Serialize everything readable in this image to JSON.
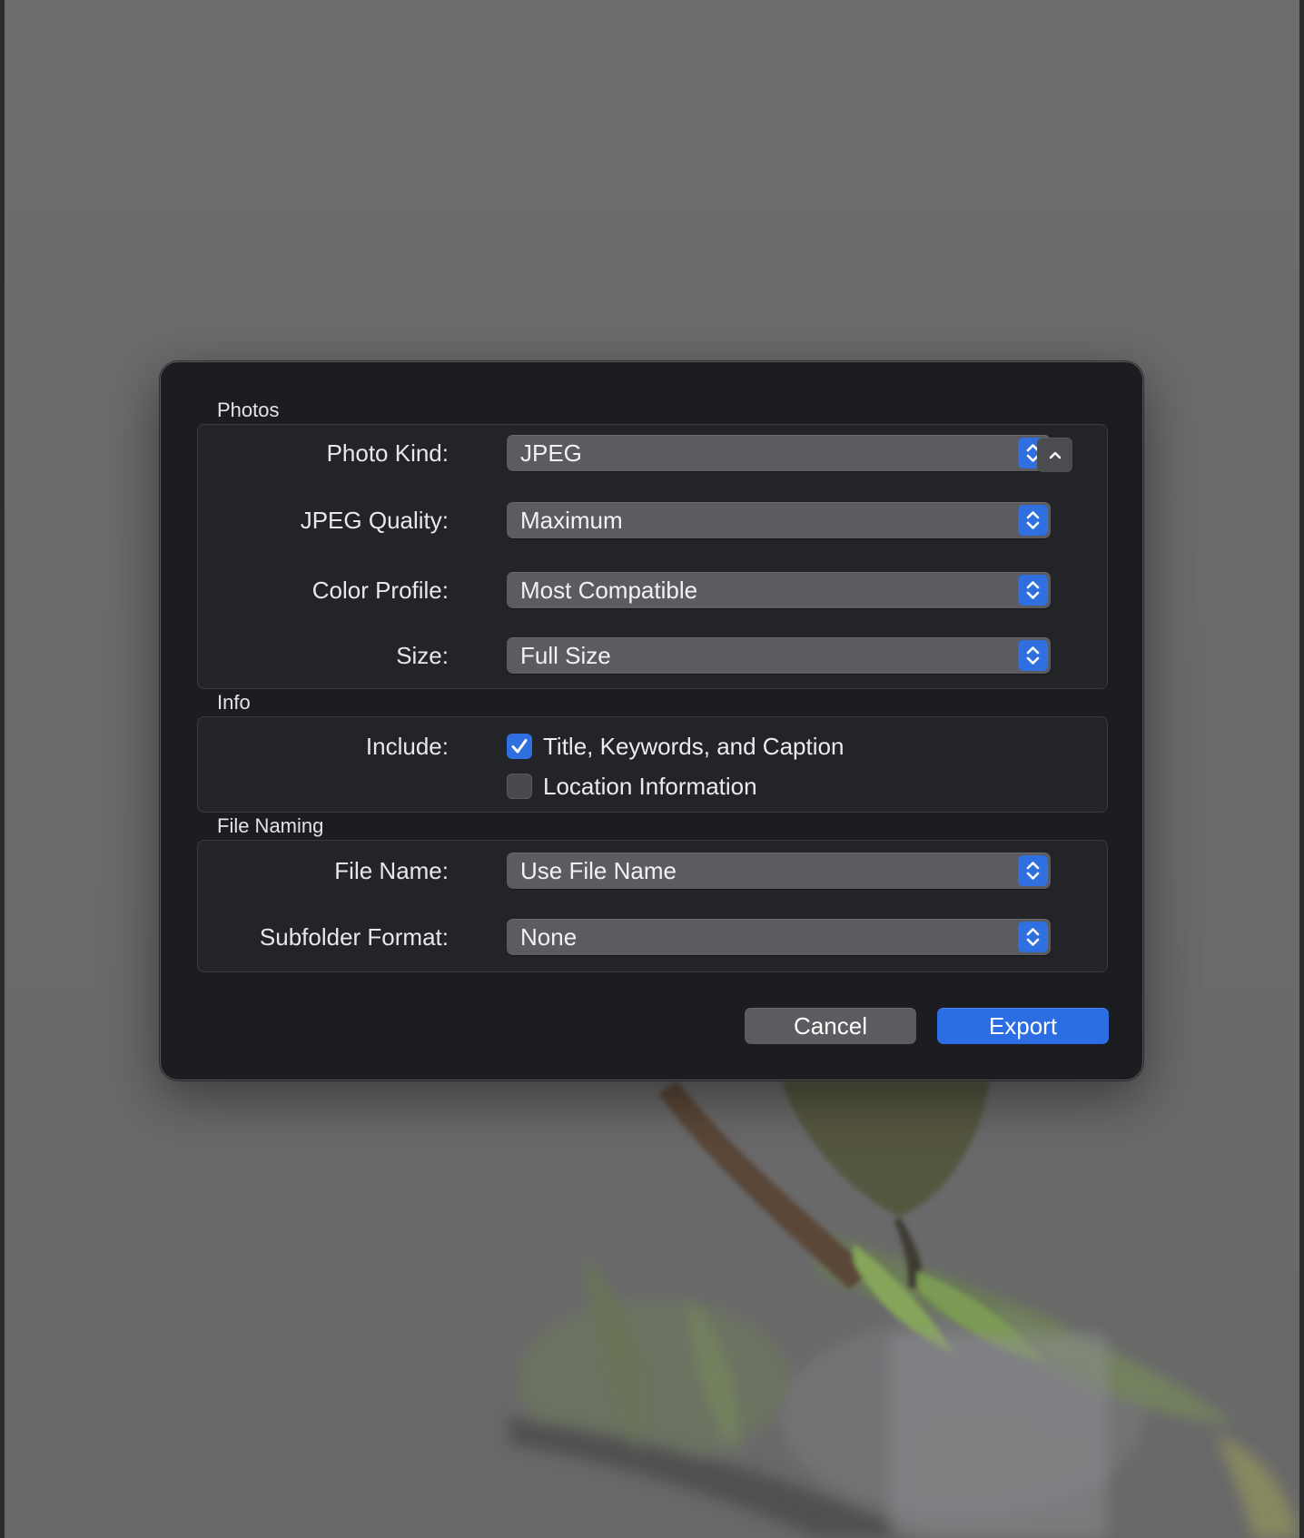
{
  "sections": {
    "photos": {
      "title": "Photos",
      "photo_kind": {
        "label": "Photo Kind:",
        "value": "JPEG"
      },
      "jpeg_quality": {
        "label": "JPEG Quality:",
        "value": "Maximum"
      },
      "color_profile": {
        "label": "Color Profile:",
        "value": "Most Compatible"
      },
      "size": {
        "label": "Size:",
        "value": "Full Size"
      }
    },
    "info": {
      "title": "Info",
      "include_label": "Include:",
      "options": [
        {
          "label": "Title, Keywords, and Caption",
          "checked": true
        },
        {
          "label": "Location Information",
          "checked": false
        }
      ]
    },
    "file_naming": {
      "title": "File Naming",
      "file_name": {
        "label": "File Name:",
        "value": "Use File Name"
      },
      "subfolder_format": {
        "label": "Subfolder Format:",
        "value": "None"
      }
    }
  },
  "buttons": {
    "cancel": "Cancel",
    "export": "Export"
  },
  "icons": {
    "stepper": "chevron-up-down-icon",
    "collapse": "chevron-up-icon",
    "check": "checkmark-icon"
  },
  "colors": {
    "accent": "#2f6fe0",
    "dialog_bg": "#1c1d20",
    "group_bg": "#232428",
    "popup_bg": "#5c5c60"
  }
}
